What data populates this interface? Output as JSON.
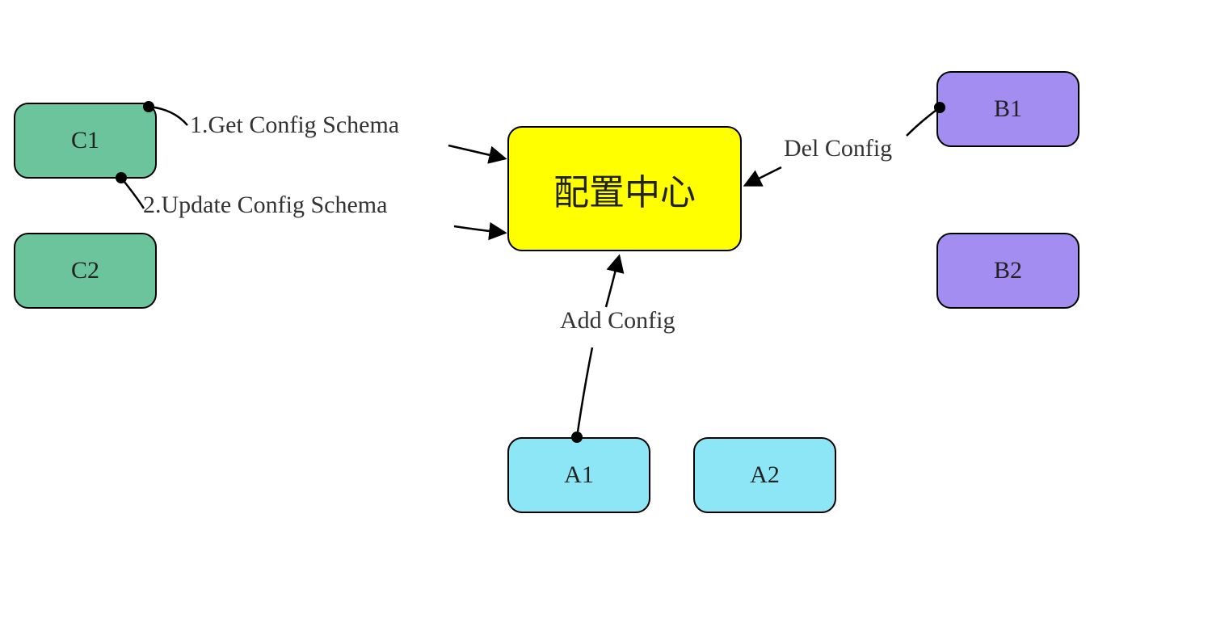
{
  "center": {
    "label": "配置中心"
  },
  "nodes": {
    "c1": "C1",
    "c2": "C2",
    "b1": "B1",
    "b2": "B2",
    "a1": "A1",
    "a2": "A2"
  },
  "edges": {
    "get_schema": "1.Get Config Schema",
    "update_schema": "2.Update Config Schema",
    "del_config": "Del Config",
    "add_config": "Add Config"
  },
  "colors": {
    "green": "#6bc49b",
    "purple": "#a38df0",
    "cyan": "#8de6f5",
    "yellow": "#ffff00",
    "stroke": "#000000"
  }
}
